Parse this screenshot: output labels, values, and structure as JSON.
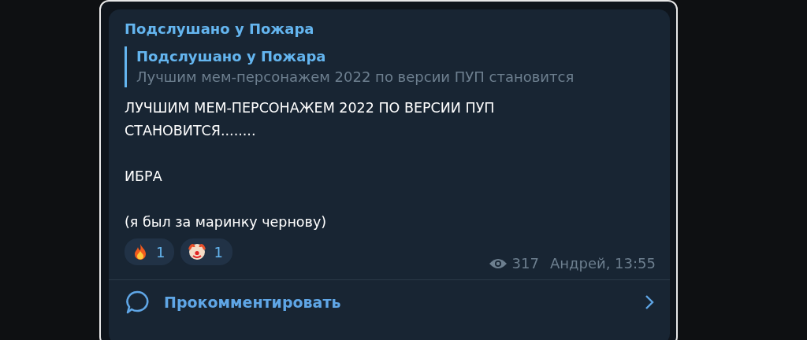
{
  "channel_title": "Подслушано у Пожара",
  "forwarded": {
    "title": "Подслушано у Пожара",
    "preview": "Лучшим мем-персонажем 2022 по версии ПУП становится"
  },
  "body": [
    "ЛУЧШИМ МЕМ-ПЕРСОНАЖЕМ 2022 ПО ВЕРСИИ ПУП СТАНОВИТСЯ........",
    "ИБРА",
    "(я был за маринку чернову)"
  ],
  "reactions": [
    {
      "kind": "fire",
      "count": "1"
    },
    {
      "kind": "clown",
      "count": "1"
    }
  ],
  "views": "317",
  "signature": "Андрей, 13:55",
  "comment_button": "Прокомментировать"
}
